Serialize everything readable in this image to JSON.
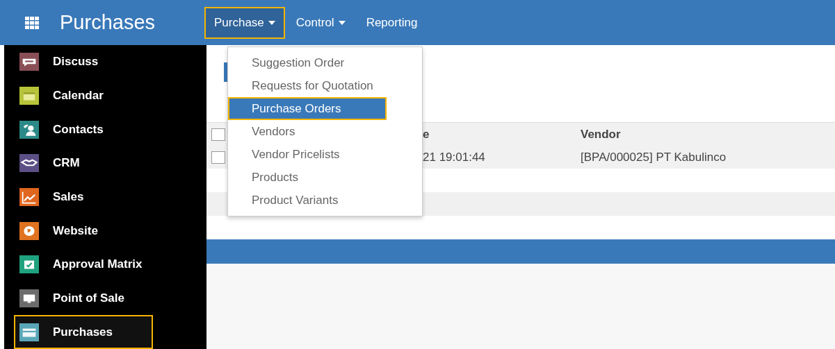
{
  "app_bar": {
    "title": "Purchases",
    "menus": [
      {
        "label": "Purchase",
        "has_caret": true,
        "selected": true,
        "highlighted": true
      },
      {
        "label": "Control",
        "has_caret": true,
        "selected": false,
        "highlighted": false
      },
      {
        "label": "Reporting",
        "has_caret": false,
        "selected": false,
        "highlighted": false
      }
    ]
  },
  "sidebar": {
    "items": [
      {
        "label": "Discuss",
        "color": "#8a4f56",
        "selected": false,
        "highlighted": false
      },
      {
        "label": "Calendar",
        "color": "#b7c43a",
        "selected": false,
        "highlighted": false
      },
      {
        "label": "Contacts",
        "color": "#2b8a88",
        "selected": false,
        "highlighted": false
      },
      {
        "label": "CRM",
        "color": "#5b4f86",
        "selected": false,
        "highlighted": false
      },
      {
        "label": "Sales",
        "color": "#e0661f",
        "selected": false,
        "highlighted": false
      },
      {
        "label": "Website",
        "color": "#e0731f",
        "selected": false,
        "highlighted": false
      },
      {
        "label": "Approval Matrix",
        "color": "#1fa27f",
        "selected": false,
        "highlighted": false
      },
      {
        "label": "Point of Sale",
        "color": "#6c6c6c",
        "selected": false,
        "highlighted": false
      },
      {
        "label": "Purchases",
        "color": "#5aa6b8",
        "selected": true,
        "highlighted": true
      }
    ]
  },
  "dropdown": {
    "items": [
      {
        "label": "Suggestion Order",
        "selected": false,
        "highlighted": false
      },
      {
        "label": "Requests for Quotation",
        "selected": false,
        "highlighted": false
      },
      {
        "label": "Purchase Orders",
        "selected": true,
        "highlighted": true
      },
      {
        "label": "Vendors",
        "selected": false,
        "highlighted": false
      },
      {
        "label": "Vendor Pricelists",
        "selected": false,
        "highlighted": false
      },
      {
        "label": "Products",
        "selected": false,
        "highlighted": false
      },
      {
        "label": "Product Variants",
        "selected": false,
        "highlighted": false
      }
    ]
  },
  "table": {
    "all_checked": false,
    "columns": [
      "e",
      "Vendor"
    ],
    "rows": [
      {
        "checked": false,
        "cells": [
          "21 19:01:44",
          "[BPA/000025] PT Kabulinco"
        ]
      }
    ]
  }
}
